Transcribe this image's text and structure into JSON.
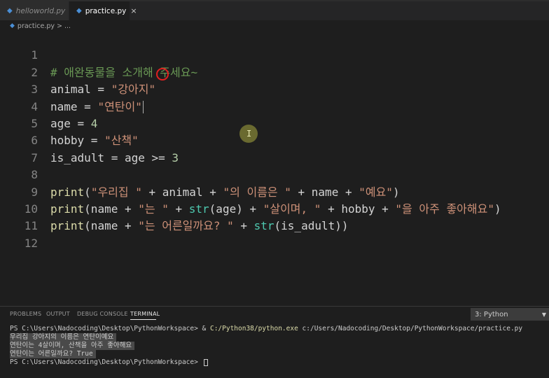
{
  "tabs": [
    {
      "label": "helloworld.py",
      "active": false
    },
    {
      "label": "practice.py",
      "active": true,
      "close": "×"
    }
  ],
  "breadcrumb": {
    "file": "practice.py",
    "sep": ">",
    "rest": "..."
  },
  "editor": {
    "line_numbers": [
      "1",
      "2",
      "3",
      "4",
      "5",
      "6",
      "7",
      "8",
      "9",
      "10",
      "11",
      "12"
    ],
    "lines": [
      {
        "t": "# 애완동물을 소개해 주세요~"
      },
      {
        "t": "animal = \"강아지\""
      },
      {
        "t": "name = \"연탄이\""
      },
      {
        "t": "age = 4"
      },
      {
        "t": "hobby = \"산책\""
      },
      {
        "t": "is_adult = age >= 3"
      },
      {
        "t": ""
      },
      {
        "t": "print(\"우리집 \" + animal + \"의 이름은 \" + name + \"예요\")"
      },
      {
        "t": "print(name + \"는 \" + str(age) + \"살이며, \" + hobby + \"을 아주 좋아해요\")"
      },
      {
        "t": "print(name + \"는 어른일까요? \" + str(is_adult))"
      },
      {
        "t": ""
      },
      {
        "t": ""
      }
    ]
  },
  "panel": {
    "tabs": [
      "PROBLEMS",
      "OUTPUT",
      "DEBUG CONSOLE",
      "TERMINAL"
    ],
    "active_tab": "TERMINAL",
    "terminal_select": "3: Python"
  },
  "terminal": {
    "cmd_prompt": "PS C:\\Users\\Nadocoding\\Desktop\\PythonWorkspace> & ",
    "cmd_exe": "C:/Python38/python.exe",
    "cmd_arg": " c:/Users/Nadocoding/Desktop/PythonWorkspace/practice.py",
    "output": [
      "우리집 강아지의 이름은 연탄이예요",
      "연탄이는 4살이며, 산책을 아주 좋아해요",
      "연탄이는 어른일까요? True"
    ],
    "prompt": "PS C:\\Users\\Nadocoding\\Desktop\\PythonWorkspace> "
  },
  "icons": {
    "python": "python-file-icon"
  },
  "colors": {
    "accent": "#4a8fd6",
    "annotation": "#e02020"
  }
}
